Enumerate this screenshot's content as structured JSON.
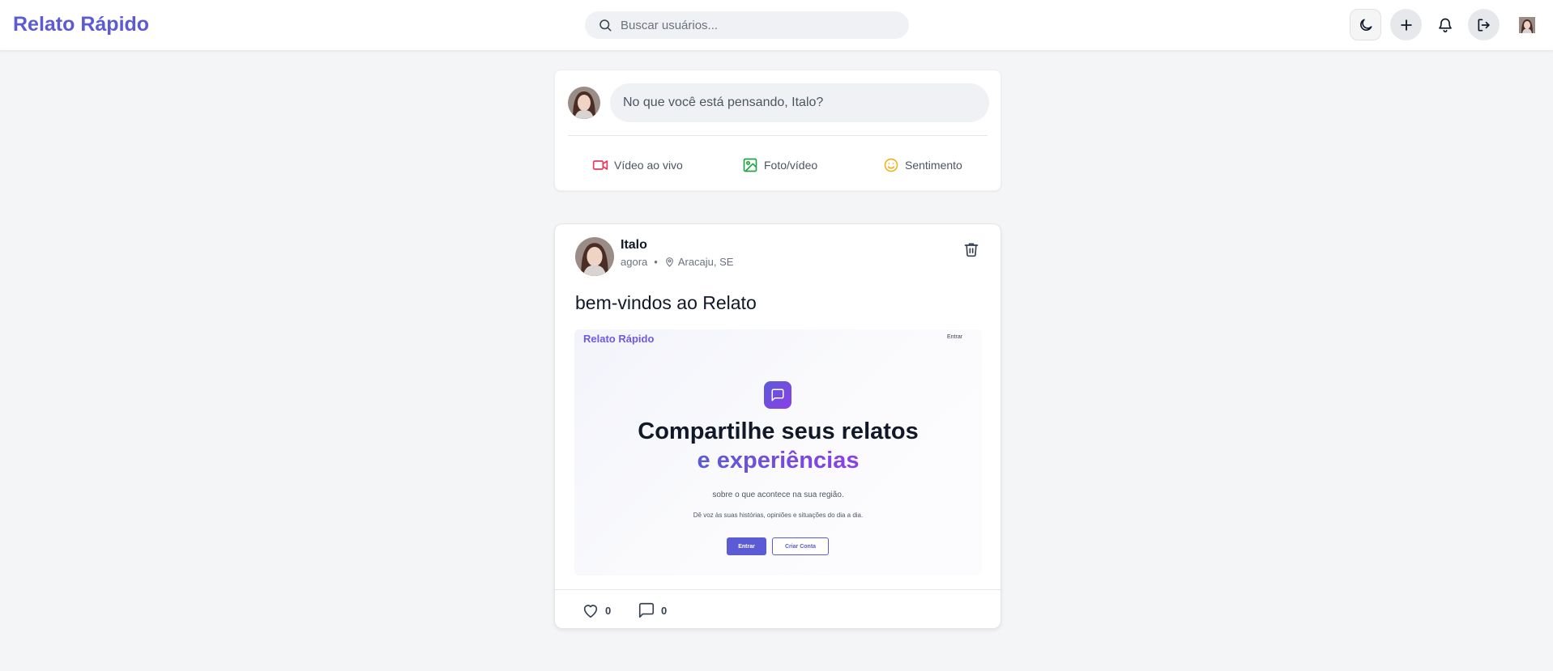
{
  "header": {
    "brand": "Relato Rápido",
    "search_placeholder": "Buscar usuários...",
    "icons": [
      "search-icon",
      "moon-icon",
      "plus-icon",
      "bell-icon",
      "logout-icon",
      "avatar"
    ]
  },
  "composer": {
    "placeholder": "No que você está pensando, Italo?",
    "actions": [
      {
        "label": "Vídeo ao vivo",
        "icon": "video-icon",
        "color": "#e8395a"
      },
      {
        "label": "Foto/vídeo",
        "icon": "image-icon",
        "color": "#22a447"
      },
      {
        "label": "Sentimento",
        "icon": "smile-icon",
        "color": "#f0b323"
      }
    ]
  },
  "post": {
    "author": "Italo",
    "time": "agora",
    "separator": "•",
    "location": "Aracaju, SE",
    "text": "bem-vindos ao Relato",
    "preview": {
      "brand": "Relato Rápido",
      "login": "Entrar",
      "heading_line1": "Compartilhe seus relatos",
      "heading_line2": "e experiências",
      "subtitle": "sobre o que acontece na sua região.",
      "description": "Dê voz às suas histórias, opiniões e situações do dia a dia.",
      "button_primary": "Entrar",
      "button_secondary": "Criar Conta"
    },
    "likes": "0",
    "comments": "0"
  },
  "colors": {
    "accent": "#5b5bd6",
    "accent_purple": "#8b3fe8",
    "background": "#f4f5f7"
  }
}
